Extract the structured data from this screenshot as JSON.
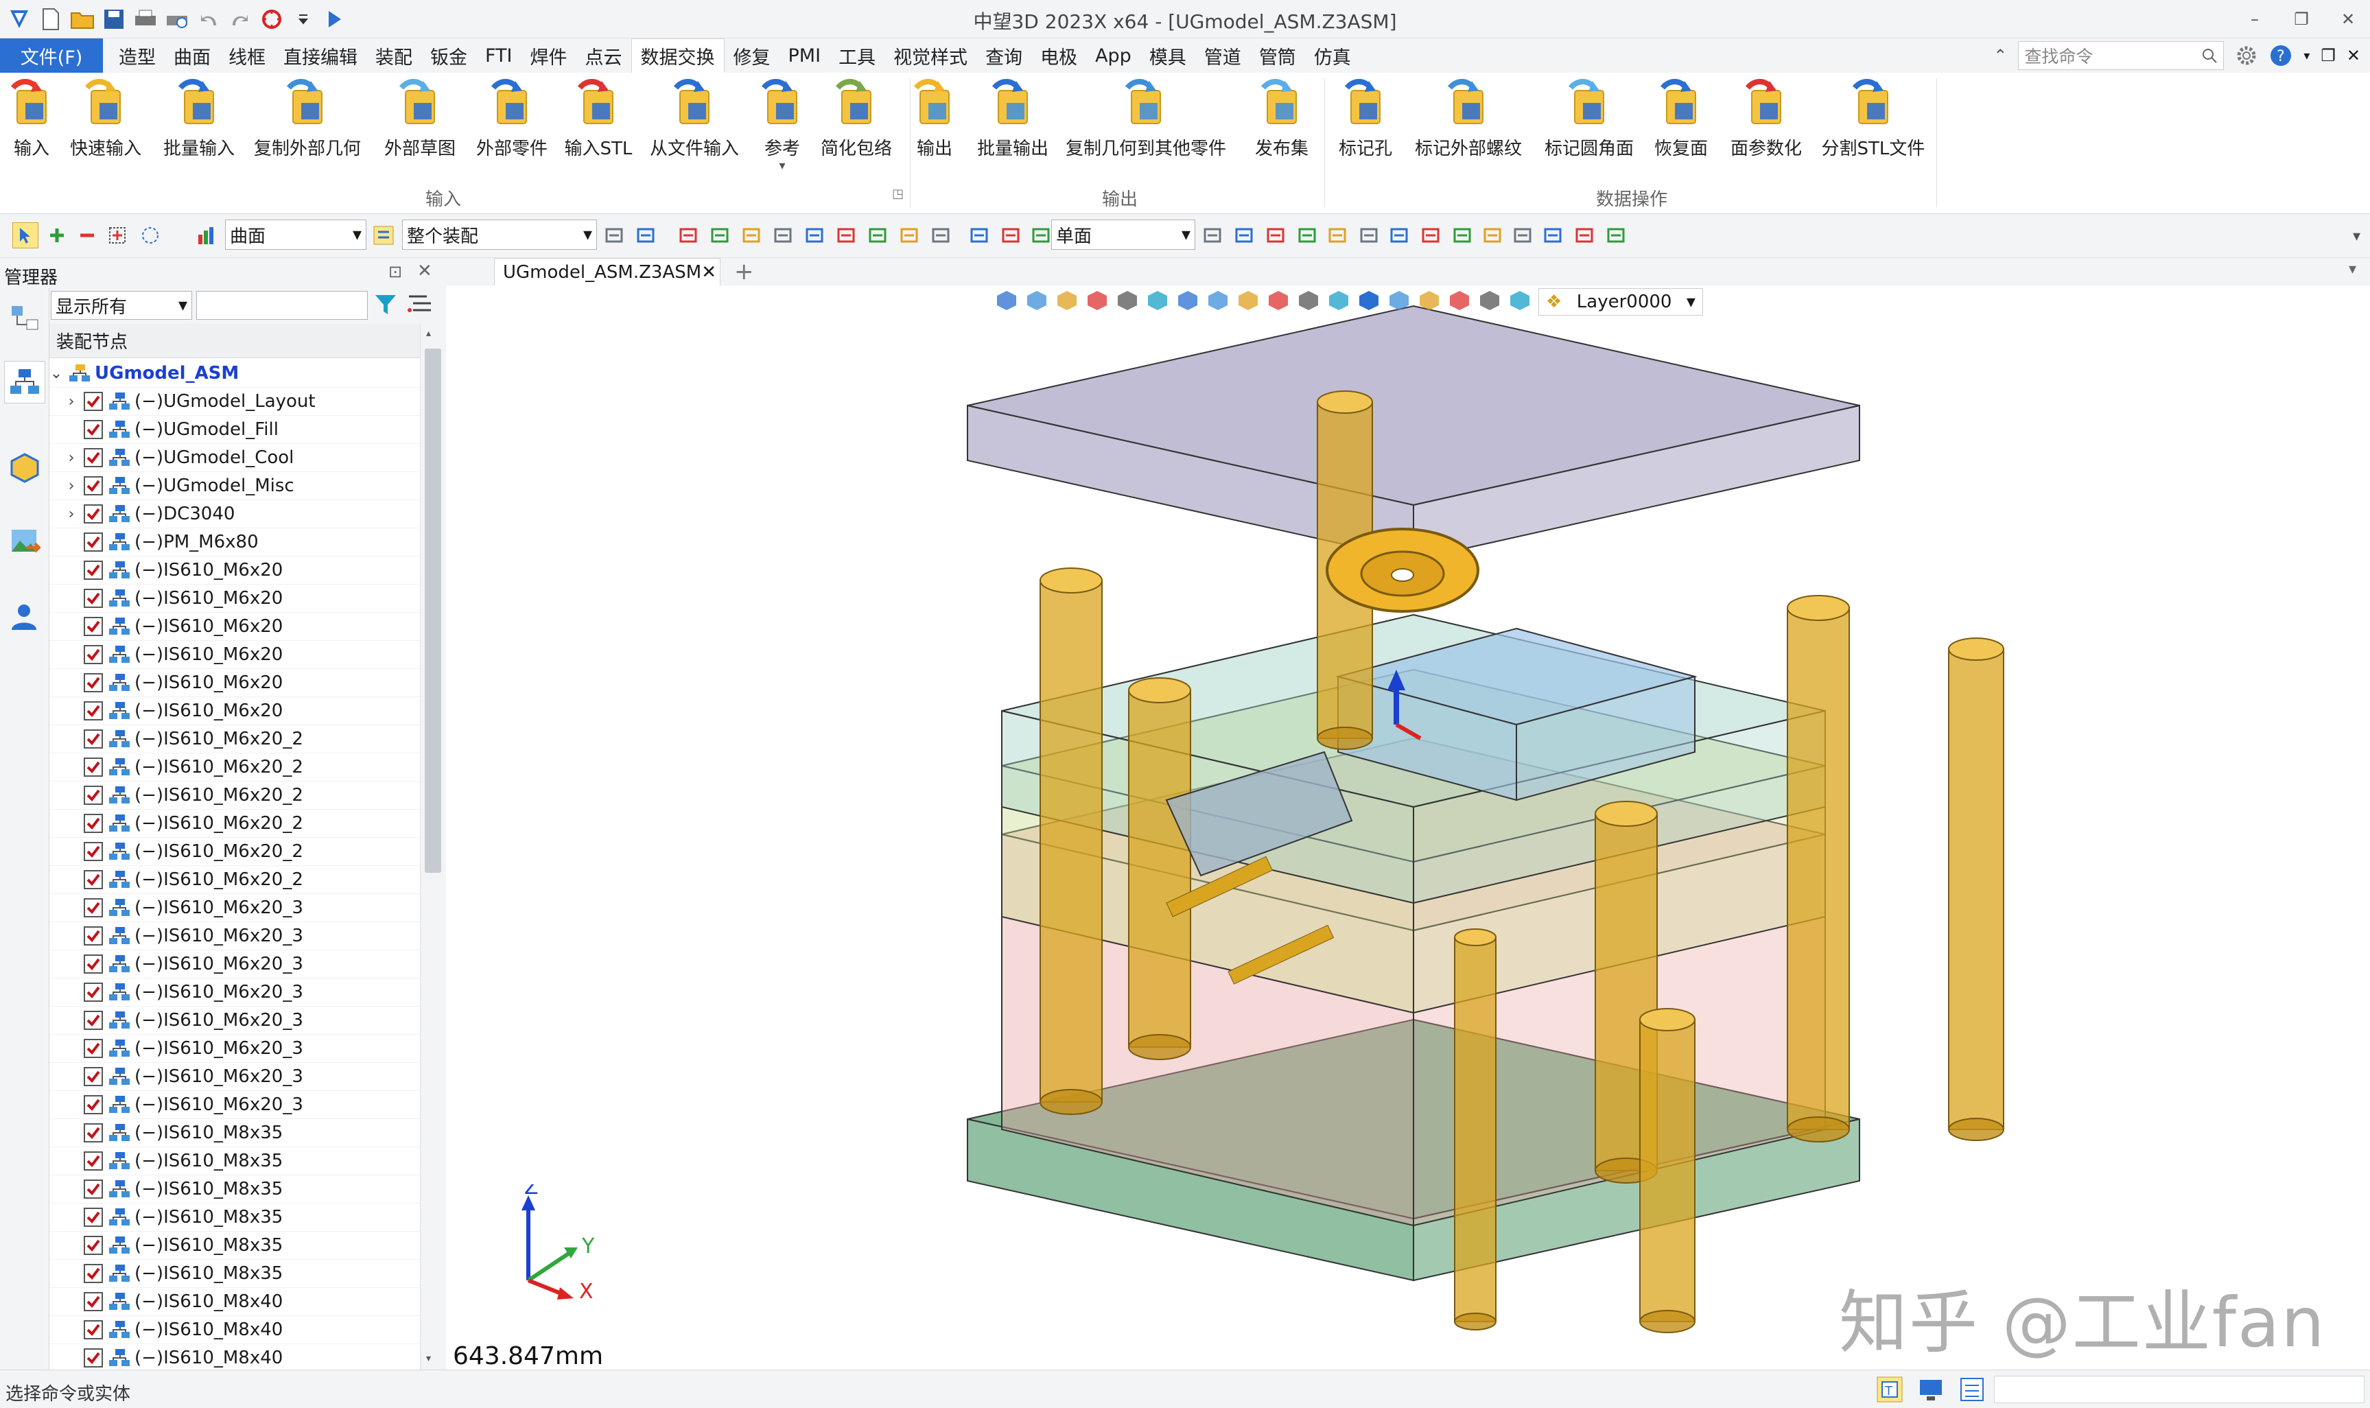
{
  "window": {
    "title": "中望3D 2023X x64 - [UGmodel_ASM.Z3ASM]"
  },
  "menu": {
    "file": "文件(F)",
    "tabs": [
      "造型",
      "曲面",
      "线框",
      "直接编辑",
      "装配",
      "钣金",
      "FTI",
      "焊件",
      "点云",
      "数据交换",
      "修复",
      "PMI",
      "工具",
      "视觉样式",
      "查询",
      "电极",
      "App",
      "模具",
      "管道",
      "管筒",
      "仿真"
    ],
    "active_tab": "数据交换",
    "search_placeholder": "查找命令"
  },
  "ribbon": {
    "input_buttons": [
      "输入",
      "快速输入",
      "批量输入",
      "复制外部几何",
      "外部草图",
      "外部零件",
      "输入STL",
      "从文件输入",
      "参考",
      "简化包络"
    ],
    "output_buttons": [
      "输出",
      "批量输出",
      "复制几何到其他零件",
      "发布集"
    ],
    "data_buttons": [
      "标记孔",
      "标记外部螺纹",
      "标记圆角面",
      "恢复面",
      "面参数化",
      "分割STL文件"
    ],
    "groups": {
      "input": "输入",
      "output": "输出",
      "data": "数据操作"
    }
  },
  "toolbar": {
    "filter_type": "曲面",
    "scope": "整个装配",
    "face_mode": "单面"
  },
  "manager": {
    "title": "管理器",
    "filter": "显示所有",
    "column": "装配节点",
    "root": "UGmodel_ASM",
    "nodes": [
      {
        "label": "(−)UGmodel_Layout",
        "expandable": true
      },
      {
        "label": "(−)UGmodel_Fill",
        "expandable": false
      },
      {
        "label": "(−)UGmodel_Cool",
        "expandable": true
      },
      {
        "label": "(−)UGmodel_Misc",
        "expandable": true
      },
      {
        "label": "(−)DC3040",
        "expandable": true
      },
      {
        "label": "(−)PM_M6x80",
        "expandable": false
      },
      {
        "label": "(−)IS610_M6x20",
        "expandable": false
      },
      {
        "label": "(−)IS610_M6x20",
        "expandable": false
      },
      {
        "label": "(−)IS610_M6x20",
        "expandable": false
      },
      {
        "label": "(−)IS610_M6x20",
        "expandable": false
      },
      {
        "label": "(−)IS610_M6x20",
        "expandable": false
      },
      {
        "label": "(−)IS610_M6x20",
        "expandable": false
      },
      {
        "label": "(−)IS610_M6x20_2",
        "expandable": false
      },
      {
        "label": "(−)IS610_M6x20_2",
        "expandable": false
      },
      {
        "label": "(−)IS610_M6x20_2",
        "expandable": false
      },
      {
        "label": "(−)IS610_M6x20_2",
        "expandable": false
      },
      {
        "label": "(−)IS610_M6x20_2",
        "expandable": false
      },
      {
        "label": "(−)IS610_M6x20_2",
        "expandable": false
      },
      {
        "label": "(−)IS610_M6x20_3",
        "expandable": false
      },
      {
        "label": "(−)IS610_M6x20_3",
        "expandable": false
      },
      {
        "label": "(−)IS610_M6x20_3",
        "expandable": false
      },
      {
        "label": "(−)IS610_M6x20_3",
        "expandable": false
      },
      {
        "label": "(−)IS610_M6x20_3",
        "expandable": false
      },
      {
        "label": "(−)IS610_M6x20_3",
        "expandable": false
      },
      {
        "label": "(−)IS610_M6x20_3",
        "expandable": false
      },
      {
        "label": "(−)IS610_M6x20_3",
        "expandable": false
      },
      {
        "label": "(−)IS610_M8x35",
        "expandable": false
      },
      {
        "label": "(−)IS610_M8x35",
        "expandable": false
      },
      {
        "label": "(−)IS610_M8x35",
        "expandable": false
      },
      {
        "label": "(−)IS610_M8x35",
        "expandable": false
      },
      {
        "label": "(−)IS610_M8x35",
        "expandable": false
      },
      {
        "label": "(−)IS610_M8x35",
        "expandable": false
      },
      {
        "label": "(−)IS610_M8x40",
        "expandable": false
      },
      {
        "label": "(−)IS610_M8x40",
        "expandable": false
      },
      {
        "label": "(−)IS610_M8x40",
        "expandable": false
      }
    ]
  },
  "document": {
    "tab": "UGmodel_ASM.Z3ASM",
    "layer": "Layer0000",
    "distance": "643.847mm",
    "axes": {
      "x": "X",
      "y": "Y",
      "z": "Z"
    },
    "watermark": "知乎 @工业fan"
  },
  "status": {
    "prompt": "选择命令或实体"
  },
  "colors": {
    "accent": "#2a6fd1",
    "checkbox": "#c0141a",
    "plate_top": "#8e86b0",
    "plate_bottom": "#4f9a6a",
    "pin_gold": "#d9a520"
  }
}
